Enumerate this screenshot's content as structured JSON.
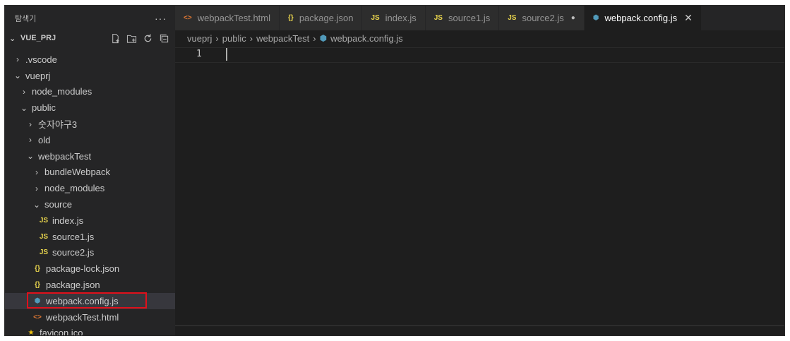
{
  "sidebar": {
    "title": "탐색기",
    "more": "···",
    "project": "VUE_PRJ",
    "tree": [
      {
        "label": ".vscode",
        "twist": "›",
        "indent": 0
      },
      {
        "label": "vueprj",
        "twist": "⌄",
        "indent": 0
      },
      {
        "label": "node_modules",
        "twist": "›",
        "indent": 1
      },
      {
        "label": "public",
        "twist": "⌄",
        "indent": 1
      },
      {
        "label": "숫자야구3",
        "twist": "›",
        "indent": 2
      },
      {
        "label": "old",
        "twist": "›",
        "indent": 2
      },
      {
        "label": "webpackTest",
        "twist": "⌄",
        "indent": 2
      },
      {
        "label": "bundleWebpack",
        "twist": "›",
        "indent": 3
      },
      {
        "label": "node_modules",
        "twist": "›",
        "indent": 3
      },
      {
        "label": "source",
        "twist": "⌄",
        "indent": 3
      },
      {
        "label": "index.js",
        "icon": "JS",
        "indent": 4
      },
      {
        "label": "source1.js",
        "icon": "JS",
        "indent": 4
      },
      {
        "label": "source2.js",
        "icon": "JS",
        "indent": 4
      },
      {
        "label": "package-lock.json",
        "icon": "{}",
        "indent": 3
      },
      {
        "label": "package.json",
        "icon": "{}",
        "indent": 3
      },
      {
        "label": "webpack.config.js",
        "icon": "cfg",
        "indent": 3
      },
      {
        "label": "webpackTest.html",
        "icon": "<>",
        "indent": 3
      },
      {
        "label": "favicon.ico",
        "icon": "fav",
        "indent": 2
      }
    ]
  },
  "tabs": [
    {
      "label": "webpackTest.html",
      "icon": "<>"
    },
    {
      "label": "package.json",
      "icon": "{}"
    },
    {
      "label": "index.js",
      "icon": "JS"
    },
    {
      "label": "source1.js",
      "icon": "JS"
    },
    {
      "label": "source2.js",
      "icon": "JS",
      "dirty": "●"
    },
    {
      "label": "webpack.config.js",
      "icon": "cfg",
      "active": true,
      "close": "✕"
    }
  ],
  "breadcrumb": [
    "vueprj",
    "public",
    "webpackTest",
    "webpack.config.js"
  ],
  "editor": {
    "line_number": "1"
  },
  "colors": {
    "selection_outline": "#e0101b",
    "js_icon": "#e8d44d",
    "config_icon": "#519aba",
    "html_icon": "#e37933"
  }
}
